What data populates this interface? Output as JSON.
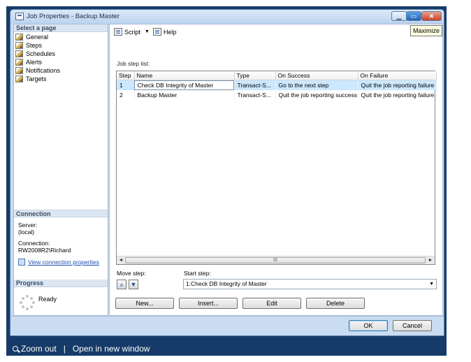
{
  "window": {
    "title": "Job Properties - Backup Master",
    "tooltip": "Maximize"
  },
  "left_pane": {
    "select_page_header": "Select a page",
    "pages": [
      {
        "label": "General"
      },
      {
        "label": "Steps"
      },
      {
        "label": "Schedules"
      },
      {
        "label": "Alerts"
      },
      {
        "label": "Notifications"
      },
      {
        "label": "Targets"
      }
    ],
    "connection_header": "Connection",
    "server_label": "Server:",
    "server_value": "(local)",
    "connection_label": "Connection:",
    "connection_value": "RW2008R2\\Richard",
    "view_connection_link": "View connection properties",
    "progress_header": "Progress",
    "progress_status": "Ready"
  },
  "toolbar": {
    "script_label": "Script",
    "help_label": "Help"
  },
  "job_steps": {
    "list_label": "Job step list:",
    "columns": [
      "Step",
      "Name",
      "Type",
      "On Success",
      "On Failure"
    ],
    "rows": [
      {
        "step": "1",
        "name": "Check DB Integrity of Master",
        "type": "Transact-S...",
        "on_success": "Go to the next step",
        "on_failure": "Quit the job reporting failure"
      },
      {
        "step": "2",
        "name": "Backup Master",
        "type": "Transact-S...",
        "on_success": "Quit the job reporting success",
        "on_failure": "Quit the job reporting failure"
      }
    ],
    "scroll_thumb_grip": "III"
  },
  "move_step_label": "Move step:",
  "start_step": {
    "label": "Start step:",
    "value": "1:Check DB Integrity of Master"
  },
  "action_buttons": {
    "new": "New...",
    "insert": "Insert...",
    "edit": "Edit",
    "delete": "Delete"
  },
  "dialog_buttons": {
    "ok": "OK",
    "cancel": "Cancel"
  },
  "footer": {
    "zoom_out": "Zoom out",
    "separator": "|",
    "open_new_window": "Open in new window"
  },
  "colors": {
    "frame": "#163b68",
    "window_bg": "#c9dcf2",
    "selection": "#cce8ff",
    "link": "#1f4fb0"
  }
}
